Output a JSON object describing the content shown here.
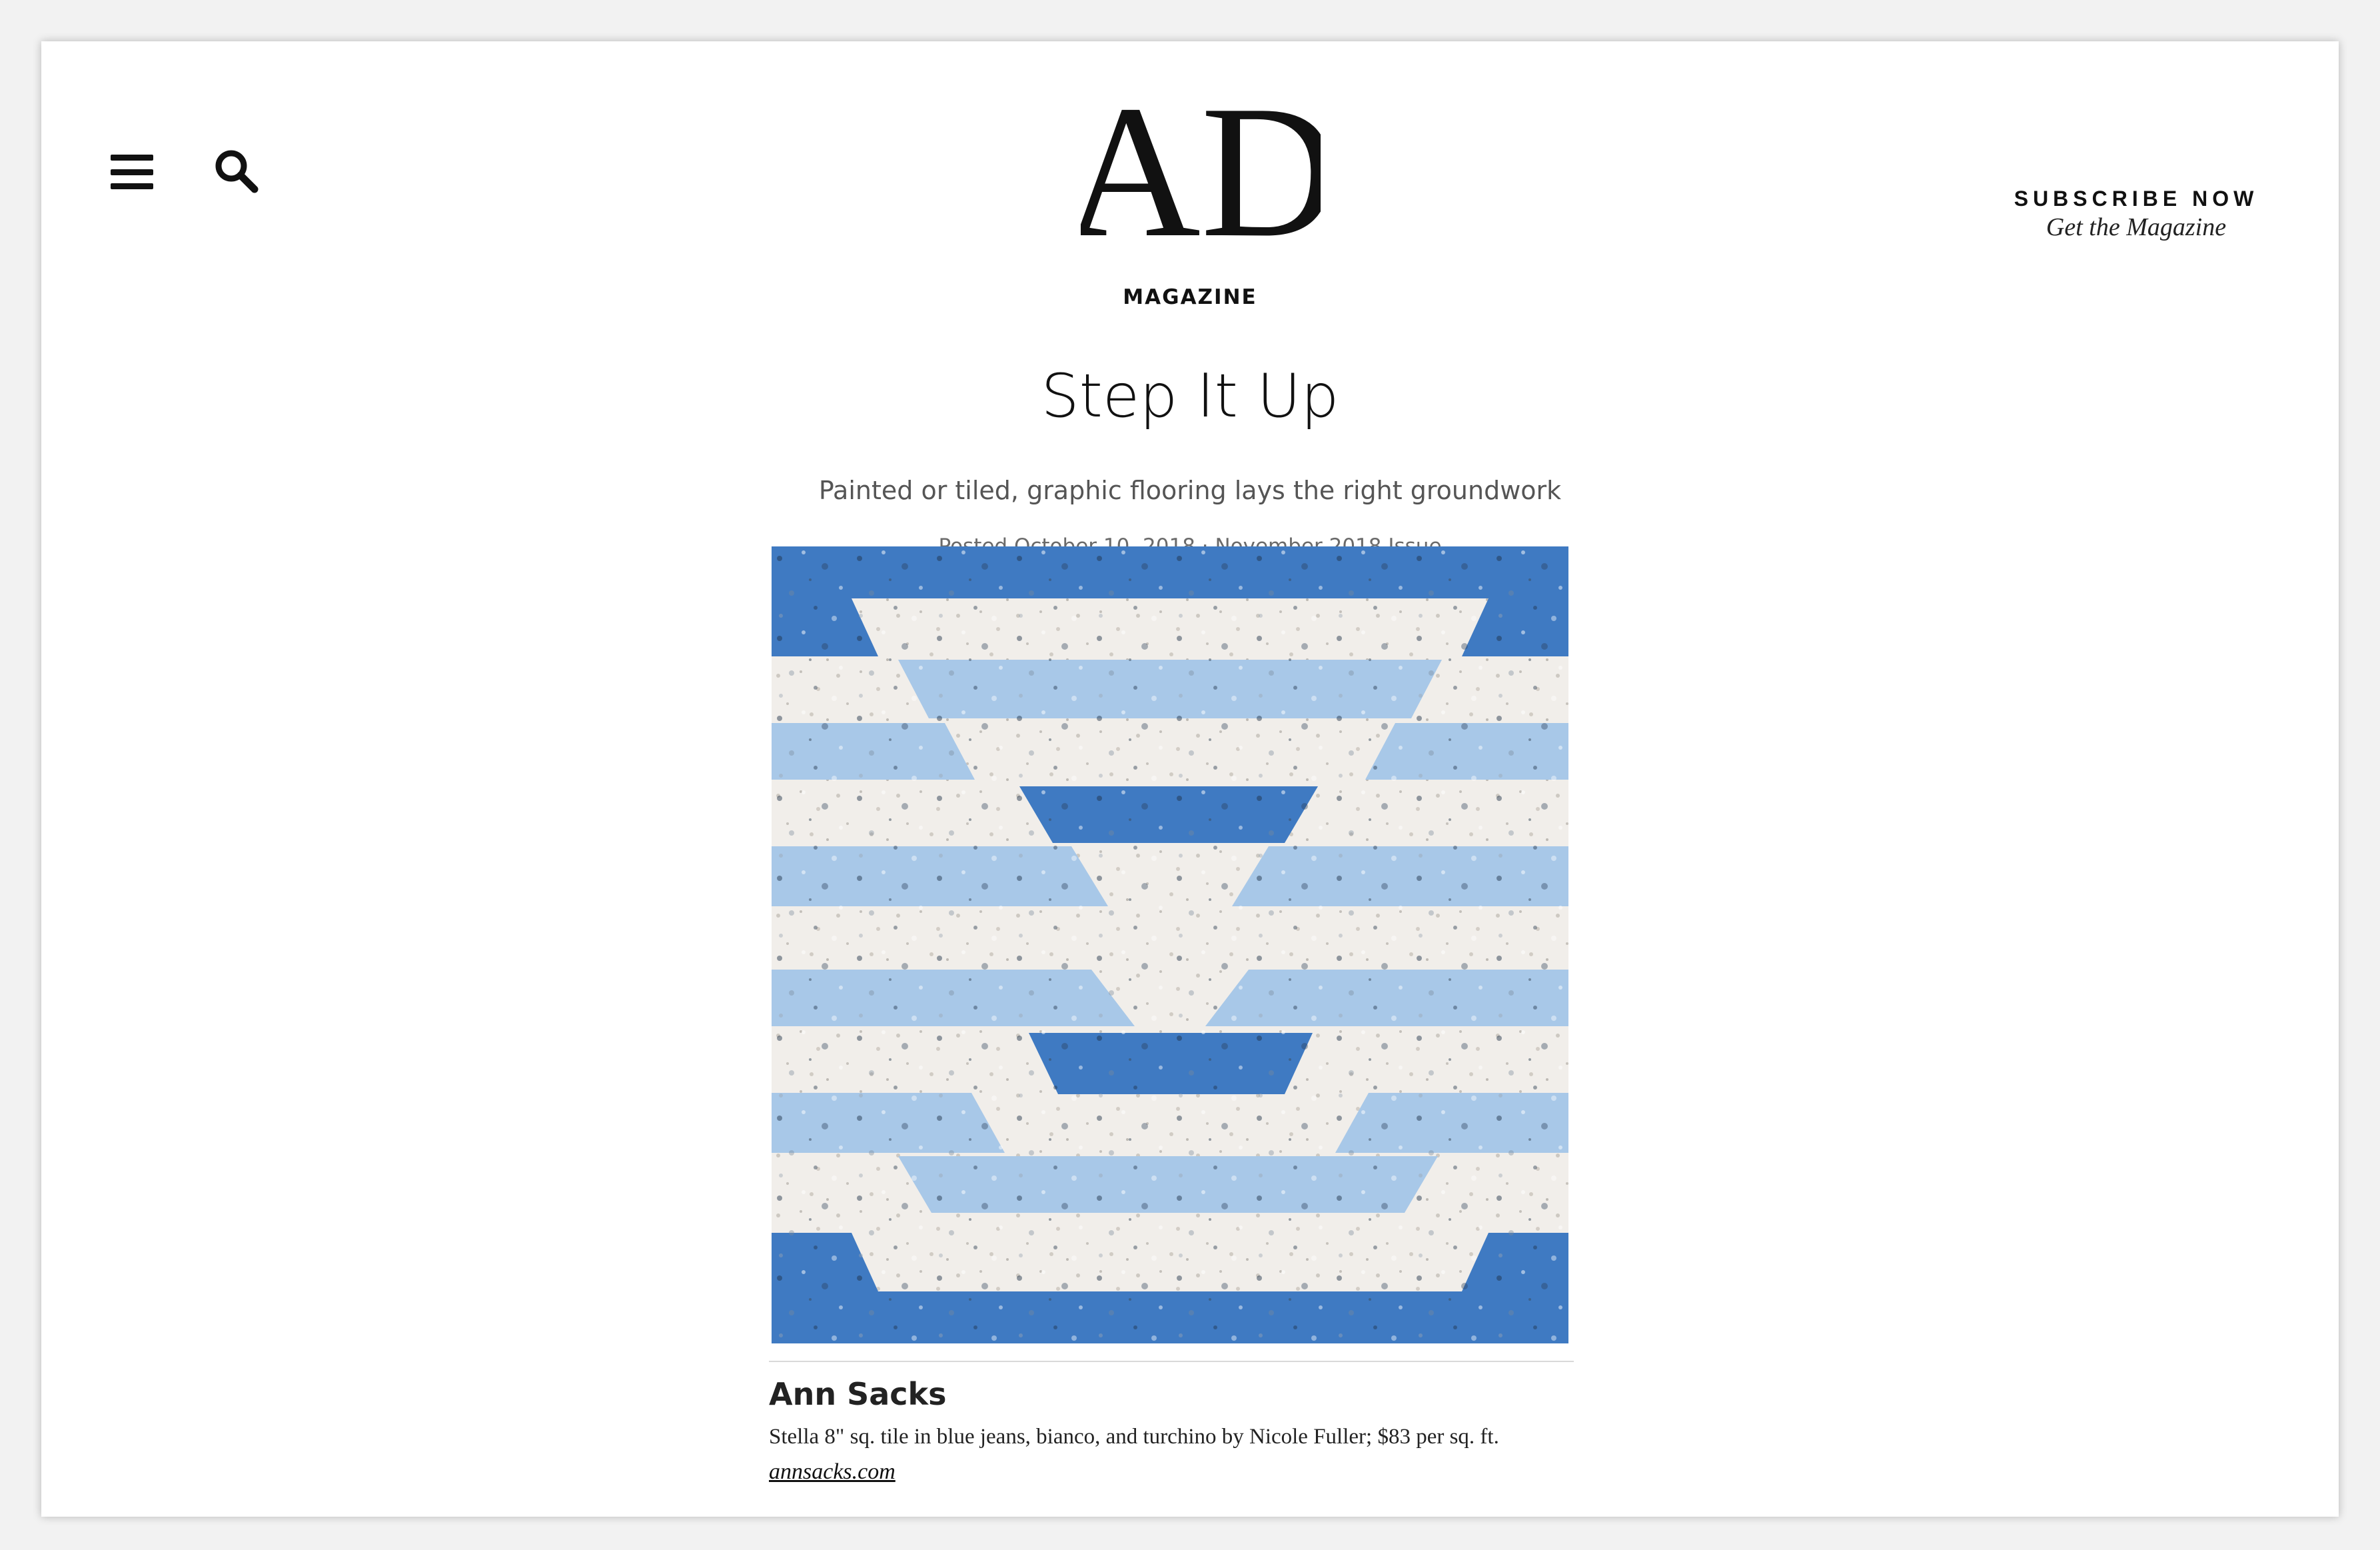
{
  "header": {
    "logo_text": "AD",
    "menu_icon": "hamburger-menu-icon",
    "search_icon": "search-icon",
    "subscribe_cta": "SUBSCRIBE NOW",
    "subscribe_sub": "Get the Magazine"
  },
  "article": {
    "rubric": "MAGAZINE",
    "headline": "Step It Up",
    "dek": "Painted or tiled, graphic flooring lays the right groundwork",
    "posted": "Posted October 10, 2018 · ",
    "issue_link": "November 2018 Issue"
  },
  "product": {
    "brand": "Ann Sacks",
    "description": "Stella 8\" sq. tile in blue jeans, bianco, and turchino by Nicole Fuller; $83 per sq. ft.",
    "link": "annsacks.com"
  },
  "colors": {
    "dark_blue": "#3f7ac2",
    "light_blue": "#a8c8e8",
    "bianco": "#f1eeea"
  }
}
